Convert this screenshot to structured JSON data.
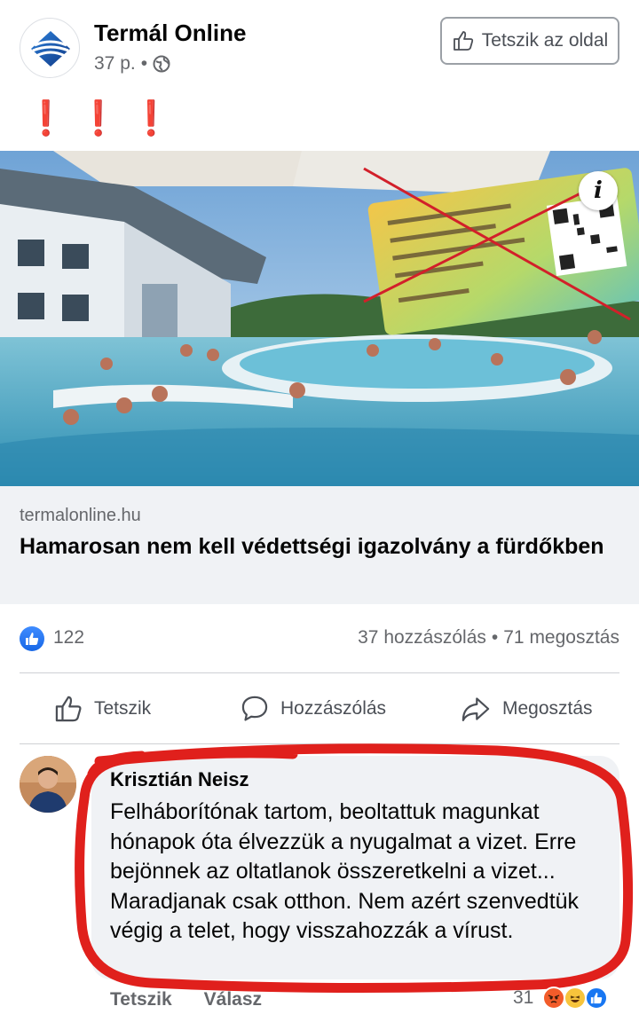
{
  "post": {
    "page_name": "Termál Online",
    "time": "37 p.",
    "separator": "•",
    "like_page_label": "Tetszik az oldal",
    "exclamations": "❗❗❗"
  },
  "link": {
    "domain": "termalonline.hu",
    "title": "Hamarosan nem kell védettségi igazolvány a fürdőkben",
    "image_icon": "info-icon",
    "image_info": "i"
  },
  "stats": {
    "likes": "122",
    "comments": "37 hozzászólás",
    "dot": "•",
    "shares": "71 megosztás"
  },
  "actions": {
    "like": "Tetszik",
    "comment": "Hozzászólás",
    "share": "Megosztás"
  },
  "comment": {
    "author": "Krisztián Neisz",
    "text": "Felháborítónak tartom, beoltattuk magunkat hónapok óta élvezzük a nyugalmat a vizet. Erre bejönnek az oltatlanok összeretkelni a vizet... Maradjanak csak otthon. Nem azért szenvedtük végig a telet, hogy visszahozzák a vírust.",
    "like_label": "Tetszik",
    "reply_label": "Válasz",
    "reaction_count": "31",
    "reactions": [
      "angry-icon",
      "haha-icon",
      "like-icon"
    ]
  },
  "colors": {
    "accent": "#1877f2",
    "annotation_red": "#e0201c",
    "secondary_text": "#65676b"
  }
}
